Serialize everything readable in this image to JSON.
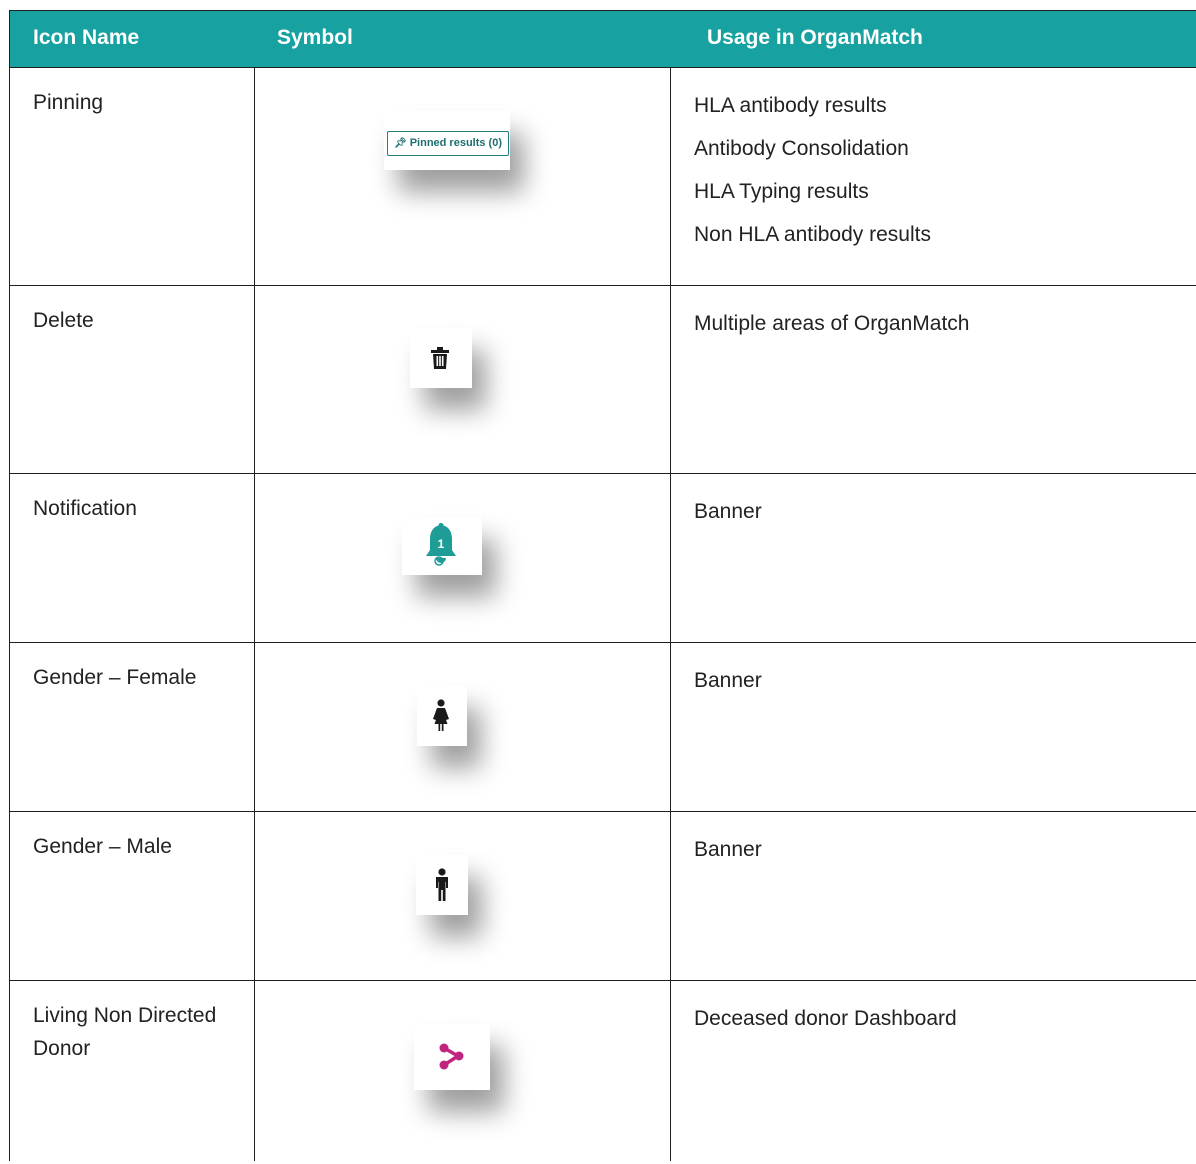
{
  "header": {
    "col1": "Icon Name",
    "col2": "Symbol",
    "col3": "Usage in OrganMatch"
  },
  "rows": [
    {
      "name": "Pinning",
      "icon": "pinned-results-button",
      "button_label": "Pinned results (0)",
      "usage": [
        "HLA antibody results",
        "Antibody Consolidation",
        "HLA Typing results",
        "Non HLA antibody results"
      ]
    },
    {
      "name": "Delete",
      "icon": "trash-icon",
      "usage": [
        "Multiple areas of OrganMatch"
      ]
    },
    {
      "name": "Notification",
      "icon": "bell-icon",
      "badge": "1",
      "usage": [
        "Banner"
      ]
    },
    {
      "name": "Gender – Female",
      "icon": "female-icon",
      "usage": [
        "Banner"
      ]
    },
    {
      "name": "Gender – Male",
      "icon": "male-icon",
      "usage": [
        "Banner"
      ]
    },
    {
      "name": "Living Non Directed Donor",
      "icon": "share-icon",
      "usage": [
        "Deceased donor Dashboard"
      ]
    }
  ],
  "colors": {
    "header_bg": "#18a1a1",
    "teal_icon": "#1e9c96",
    "magenta_icon": "#c0247f",
    "dark_icon": "#1a1a1a"
  }
}
